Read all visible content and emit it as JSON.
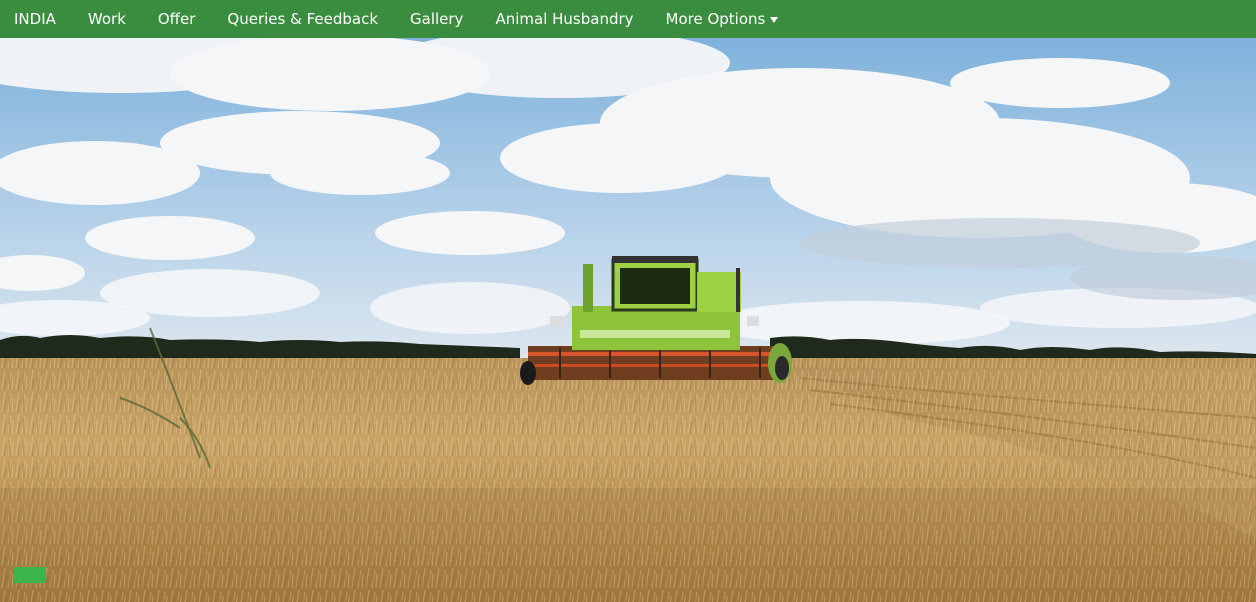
{
  "navbar": {
    "items": [
      {
        "label": "INDIA"
      },
      {
        "label": "Work"
      },
      {
        "label": "Offer"
      },
      {
        "label": "Queries & Feedback"
      },
      {
        "label": "Gallery"
      },
      {
        "label": "Animal Husbandry"
      },
      {
        "label": "More Options"
      }
    ],
    "more_icon": "caret-down-icon",
    "background": "#3a8d3f"
  },
  "hero": {
    "image": "combine harvester in wheat field under cloudy sky"
  },
  "slider": {
    "indicator_color": "#3cb54a"
  }
}
